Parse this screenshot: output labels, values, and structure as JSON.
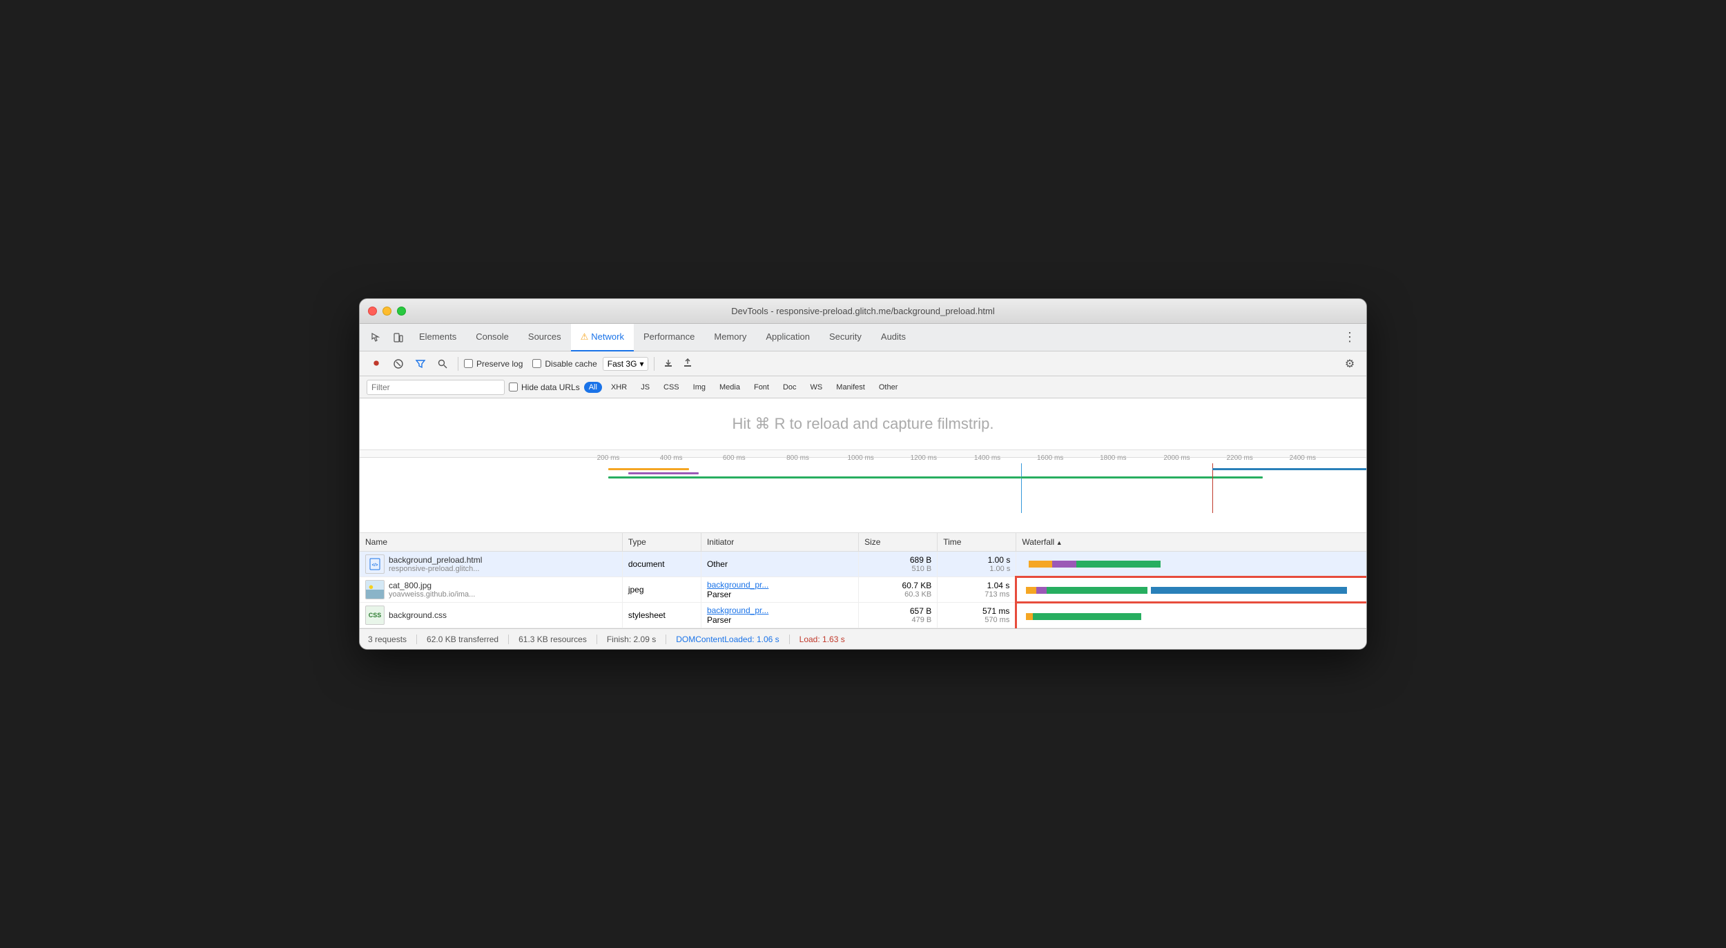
{
  "window": {
    "title": "DevTools - responsive-preload.glitch.me/background_preload.html"
  },
  "tabs": [
    {
      "label": "Elements",
      "active": false
    },
    {
      "label": "Console",
      "active": false
    },
    {
      "label": "Sources",
      "active": false
    },
    {
      "label": "Network",
      "active": true,
      "warning": true
    },
    {
      "label": "Performance",
      "active": false
    },
    {
      "label": "Memory",
      "active": false
    },
    {
      "label": "Application",
      "active": false
    },
    {
      "label": "Security",
      "active": false
    },
    {
      "label": "Audits",
      "active": false
    }
  ],
  "toolbar": {
    "preserve_log": "Preserve log",
    "disable_cache": "Disable cache",
    "throttle": "Fast 3G"
  },
  "filter": {
    "placeholder": "Filter",
    "hide_data_urls": "Hide data URLs",
    "types": [
      "All",
      "XHR",
      "JS",
      "CSS",
      "Img",
      "Media",
      "Font",
      "Doc",
      "WS",
      "Manifest",
      "Other"
    ]
  },
  "filmstrip_hint": "Hit ⌘ R to reload and capture filmstrip.",
  "ruler": {
    "marks": [
      "200 ms",
      "400 ms",
      "600 ms",
      "800 ms",
      "1000 ms",
      "1200 ms",
      "1400 ms",
      "1600 ms",
      "1800 ms",
      "2000 ms",
      "2200 ms",
      "2400 ms"
    ]
  },
  "table": {
    "columns": [
      "Name",
      "Type",
      "Initiator",
      "Size",
      "Time",
      "Waterfall"
    ],
    "rows": [
      {
        "name": "background_preload.html",
        "url": "responsive-preload.glitch...",
        "type": "document",
        "initiator": "Other",
        "initiator_link": false,
        "size": "689 B",
        "size2": "510 B",
        "time": "1.00 s",
        "time2": "1.00 s",
        "selected": true,
        "icon_type": "html"
      },
      {
        "name": "cat_800.jpg",
        "url": "yoavweiss.github.io/ima...",
        "type": "jpeg",
        "initiator": "background_pr...",
        "initiator2": "Parser",
        "initiator_link": true,
        "size": "60.7 KB",
        "size2": "60.3 KB",
        "time": "1.04 s",
        "time2": "713 ms",
        "selected": false,
        "icon_type": "jpg"
      },
      {
        "name": "background.css",
        "url": "",
        "type": "stylesheet",
        "initiator": "background_pr...",
        "initiator2": "Parser",
        "initiator_link": true,
        "size": "657 B",
        "size2": "479 B",
        "time": "571 ms",
        "time2": "570 ms",
        "selected": false,
        "icon_type": "css"
      }
    ]
  },
  "statusbar": {
    "requests": "3 requests",
    "transferred": "62.0 KB transferred",
    "resources": "61.3 KB resources",
    "finish": "Finish: 2.09 s",
    "dom_label": "DOMContentLoaded:",
    "dom_value": "1.06 s",
    "load_label": "Load:",
    "load_value": "1.63 s"
  }
}
